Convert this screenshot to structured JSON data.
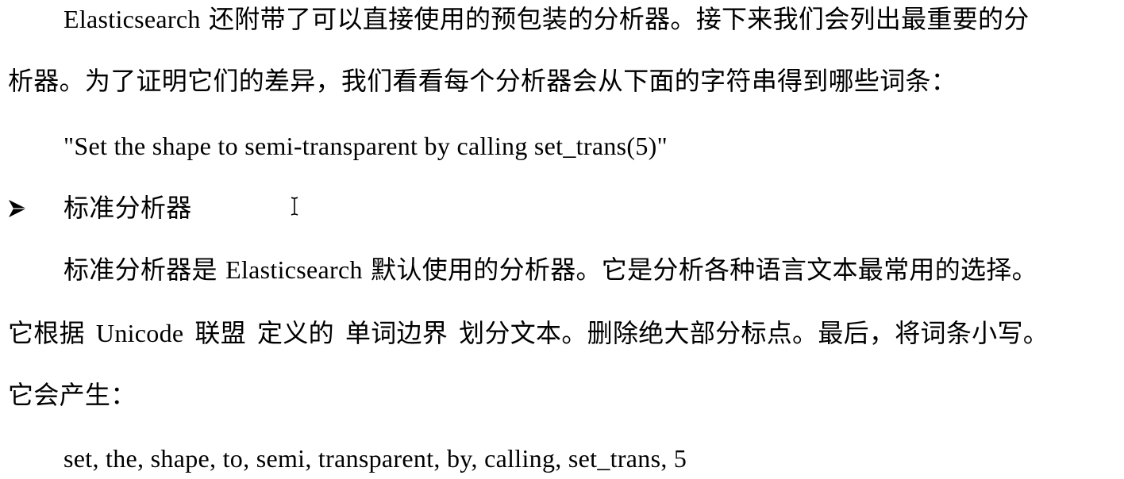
{
  "document": {
    "paragraph1_line1": "Elasticsearch 还附带了可以直接使用的预包装的分析器。接下来我们会列出最重要的分",
    "paragraph1_line2": "析器。为了证明它们的差异，我们看看每个分析器会从下面的字符串得到哪些词条：",
    "example_string": "\"Set the shape to semi-transparent by calling set_trans(5)\"",
    "bullet_heading": "标准分析器",
    "paragraph2_line1": "标准分析器是 Elasticsearch 默认使用的分析器。它是分析各种语言文本最常用的选择。",
    "paragraph2_line2_parts": [
      "它根据",
      "Unicode",
      "联盟",
      "定义的",
      "单词边界",
      "划分文本。删除绝大部分标点。最后，将词条小写。"
    ],
    "paragraph2_line3": "它会产生：",
    "token_output": "set, the, shape, to, semi, transparent, by, calling, set_trans, 5"
  },
  "icons": {
    "bullet": "arrowhead-bullet-icon",
    "cursor": "text-cursor-icon"
  }
}
